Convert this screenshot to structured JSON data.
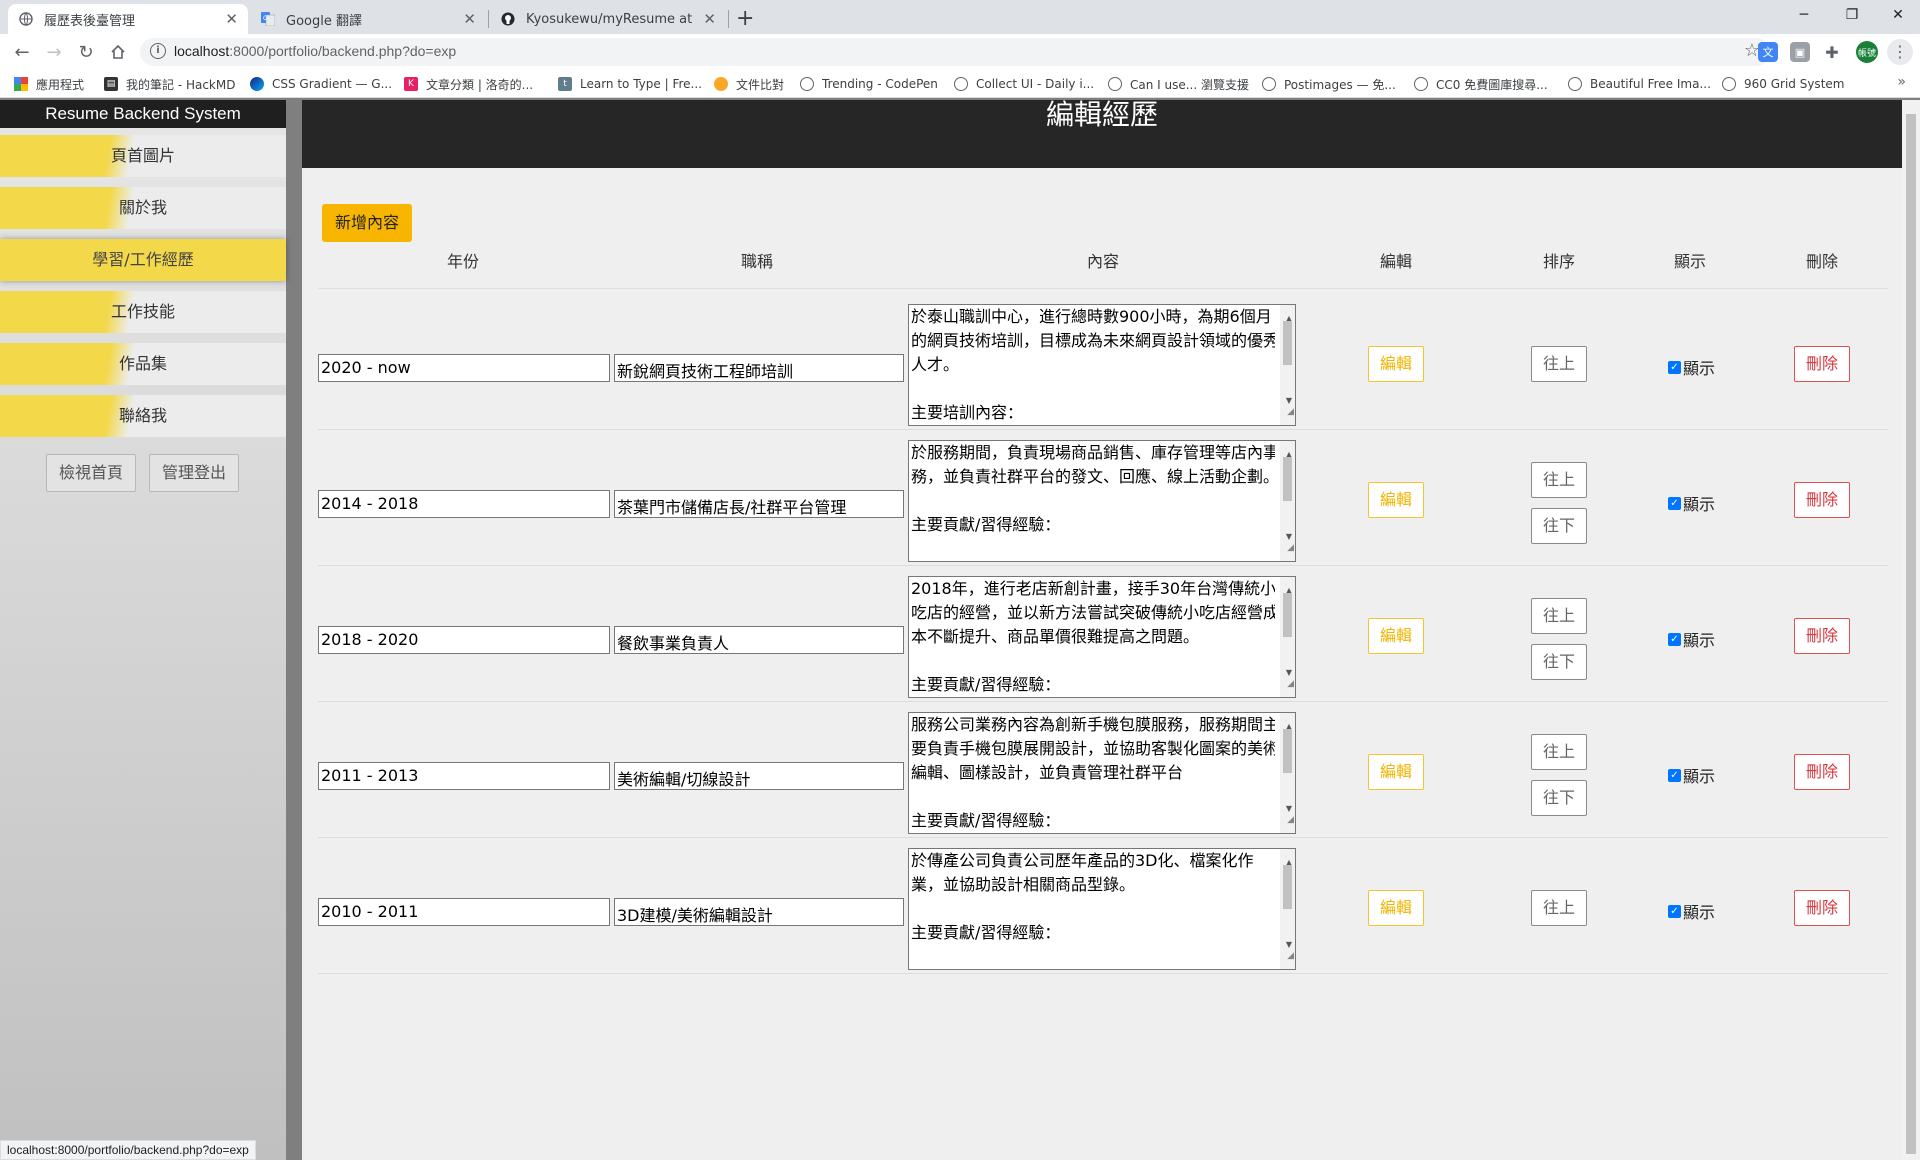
{
  "browser": {
    "tabs": [
      {
        "title": "履歷表後臺管理",
        "icon": "globe-icon"
      },
      {
        "title": "Google 翻譯",
        "icon": "google-translate-icon"
      },
      {
        "title": "Kyosukewu/myResume at back",
        "icon": "github-icon"
      }
    ],
    "url_host": "localhost",
    "url_rest": ":8000/portfolio/backend.php?do=exp",
    "bookmarks": [
      {
        "label": "應用程式",
        "icon": "apps-icon"
      },
      {
        "label": "我的筆記 - HackMD",
        "icon": "hackmd-icon"
      },
      {
        "label": "CSS Gradient — G...",
        "icon": "cssgradient-icon"
      },
      {
        "label": "文章分類 | 洛奇的...",
        "icon": "k-icon"
      },
      {
        "label": "Learn to Type | Fre...",
        "icon": "typing-icon"
      },
      {
        "label": "文件比對",
        "icon": "fruit-icon"
      },
      {
        "label": "Trending - CodePen",
        "icon": "globe-icon"
      },
      {
        "label": "Collect UI - Daily i...",
        "icon": "globe-icon"
      },
      {
        "label": "Can I use... 瀏覽支援",
        "icon": "globe-icon"
      },
      {
        "label": "Postimages — 免...",
        "icon": "globe-icon"
      },
      {
        "label": "CC0 免費圖庫搜尋...",
        "icon": "globe-icon"
      },
      {
        "label": "Beautiful Free Ima...",
        "icon": "globe-icon"
      },
      {
        "label": "960 Grid System",
        "icon": "globe-icon"
      }
    ],
    "profile_label": "帳號",
    "status_url": "localhost:8000/portfolio/backend.php?do=exp"
  },
  "sidebar": {
    "title": "Resume Backend System",
    "items": [
      {
        "label": "頁首圖片"
      },
      {
        "label": "關於我"
      },
      {
        "label": "學習/工作經歷",
        "active": true
      },
      {
        "label": "工作技能"
      },
      {
        "label": "作品集"
      },
      {
        "label": "聯絡我"
      }
    ],
    "view_home": "檢視首頁",
    "logout": "管理登出"
  },
  "main": {
    "title": "編輯經歷",
    "add_button": "新增內容",
    "columns": [
      "年份",
      "職稱",
      "內容",
      "編輯",
      "排序",
      "顯示",
      "刪除"
    ],
    "edit_label": "編輯",
    "up_label": "往上",
    "down_label": "往下",
    "show_label": "顯示",
    "delete_label": "刪除",
    "rows": [
      {
        "year": "2020 - now",
        "title": "新銳網頁技術工程師培訓",
        "content": [
          "於泰山職訓中心，進行總時數900小時，為期6個月",
          "的網頁技術培訓，目標成為未來網頁設計領域的優秀",
          "人才。",
          "",
          "主要培訓內容："
        ],
        "show": true,
        "has_up": false,
        "has_down": true
      },
      {
        "year": "2014 - 2018",
        "title": "茶葉門市儲備店長/社群平台管理",
        "content": [
          "於服務期間，負責現場商品銷售、庫存管理等店內事",
          "務，並負責社群平台的發文、回應、線上活動企劃。",
          "",
          "主要貢獻/習得經驗："
        ],
        "show": true,
        "has_up": true,
        "has_down": true
      },
      {
        "year": "2018 - 2020",
        "title": "餐飲事業負責人",
        "content": [
          "2018年，進行老店新創計畫，接手30年台灣傳統小",
          "吃店的經營，並以新方法嘗試突破傳統小吃店經營成",
          "本不斷提升、商品單價很難提高之問題。",
          "",
          "主要貢獻/習得經驗："
        ],
        "show": true,
        "has_up": true,
        "has_down": true
      },
      {
        "year": "2011 - 2013",
        "title": "美術編輯/切線設計",
        "content": [
          "服務公司業務內容為創新手機包膜服務，服務期間主",
          "要負責手機包膜展開設計，並協助客製化圖案的美術",
          "編輯、圖樣設計，並負責管理社群平台",
          "",
          "主要貢獻/習得經驗："
        ],
        "show": true,
        "has_up": true,
        "has_down": true
      },
      {
        "year": "2010 - 2011",
        "title": "3D建模/美術編輯設計",
        "content": [
          "於傳產公司負責公司歷年產品的3D化、檔案化作",
          "業，並協助設計相關商品型錄。",
          "",
          "主要貢獻/習得經驗："
        ],
        "show": true,
        "has_up": true,
        "has_down": false
      }
    ]
  }
}
